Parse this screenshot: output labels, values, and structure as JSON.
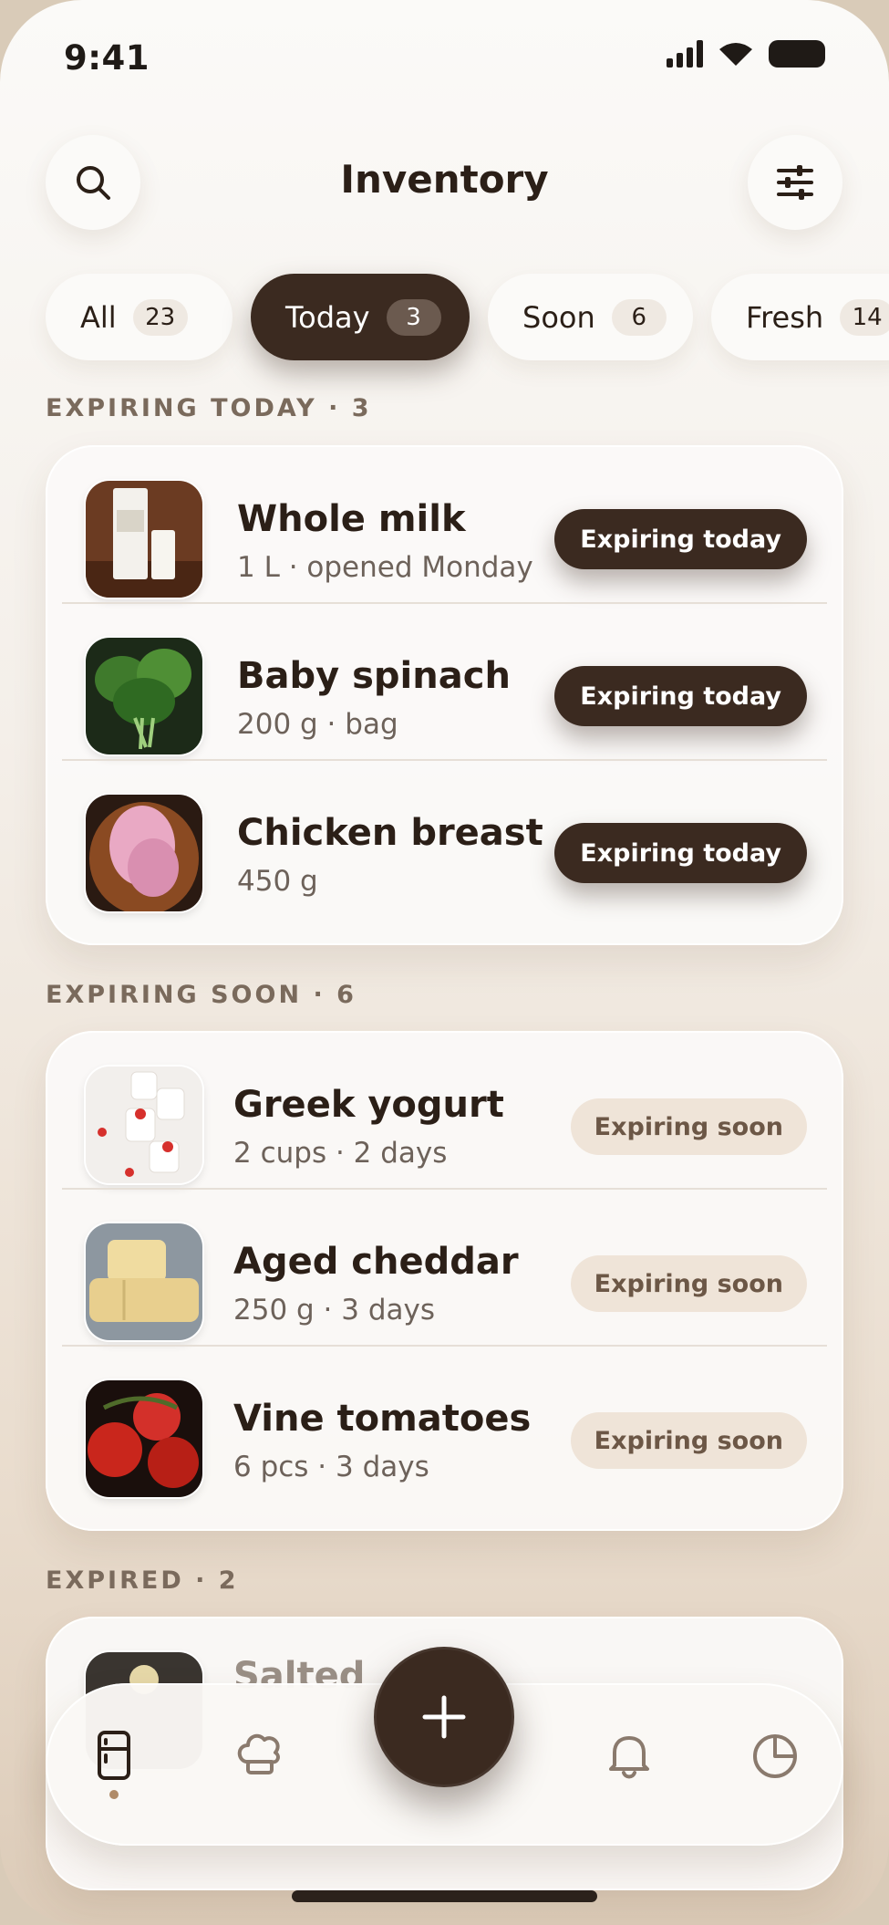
{
  "status_bar": {
    "time": "9:41"
  },
  "header": {
    "title": "Inventory",
    "search_icon": "search-icon",
    "filter_icon": "sliders-icon"
  },
  "filters": [
    {
      "label": "All",
      "count": "23",
      "active": false
    },
    {
      "label": "Today",
      "count": "3",
      "active": true
    },
    {
      "label": "Soon",
      "count": "6",
      "active": false
    },
    {
      "label": "Fresh",
      "count": "14",
      "active": false
    }
  ],
  "sections": {
    "today": {
      "title": "EXPIRING TODAY · 3",
      "items": [
        {
          "name": "Whole milk",
          "meta": "1 L · opened Monday",
          "badge": "Expiring today",
          "image": "milk-carton-photo"
        },
        {
          "name": "Baby spinach",
          "meta": "200 g · bag",
          "badge": "Expiring today",
          "image": "spinach-photo"
        },
        {
          "name": "Chicken breast",
          "meta": "450 g",
          "badge": "Expiring today",
          "image": "chicken-photo"
        }
      ]
    },
    "soon": {
      "title": "EXPIRING SOON · 6",
      "items": [
        {
          "name": "Greek yogurt",
          "meta": "2 cups · 2 days",
          "badge": "Expiring soon",
          "image": "yogurt-photo"
        },
        {
          "name": "Aged cheddar",
          "meta": "250 g · 3 days",
          "badge": "Expiring soon",
          "image": "cheese-photo"
        },
        {
          "name": "Vine tomatoes",
          "meta": "6 pcs · 3 days",
          "badge": "Expiring soon",
          "image": "tomatoes-photo"
        }
      ]
    },
    "expired": {
      "title": "EXPIRED · 2",
      "items": [
        {
          "name": "Salted",
          "image": "food-photo"
        }
      ]
    }
  },
  "tab_bar": {
    "tabs": [
      "fridge-icon",
      "chef-hat-icon",
      "bell-icon",
      "pie-chart-icon"
    ],
    "fab_icon": "plus-icon",
    "active_tab": "fridge-icon"
  },
  "colors": {
    "accent_dark": "#3b2a20",
    "soon_badge_bg": "#efe4d8",
    "soon_badge_text": "#6c5746",
    "section_title": "#7a6a5c"
  }
}
